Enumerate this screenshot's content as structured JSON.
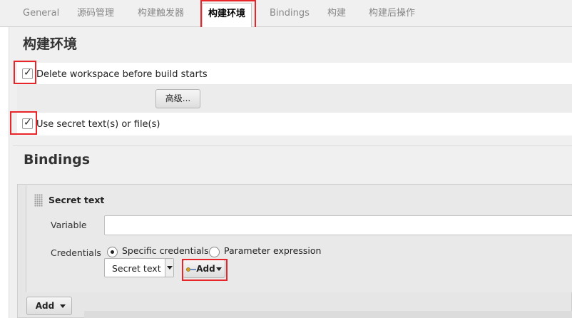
{
  "tabs": [
    {
      "label": "General",
      "active": false
    },
    {
      "label": "源码管理",
      "active": false
    },
    {
      "label": "构建触发器",
      "active": false
    },
    {
      "label": "构建环境",
      "active": true
    },
    {
      "label": "Bindings",
      "active": false
    },
    {
      "label": "构建",
      "active": false
    },
    {
      "label": "构建后操作",
      "active": false
    }
  ],
  "build_env": {
    "title": "构建环境",
    "delete_workspace_label": "Delete workspace before build starts",
    "delete_workspace_checked": true,
    "advanced_button": "高级...",
    "use_secret_label": "Use secret text(s) or file(s)",
    "use_secret_checked": true
  },
  "bindings": {
    "title": "Bindings",
    "card_title": "Secret text",
    "variable_label": "Variable",
    "variable_value": "",
    "credentials_label": "Credentials",
    "radio_specific": "Specific credentials",
    "radio_parameter": "Parameter expression",
    "selected_radio": "specific",
    "credential_select_value": "Secret text",
    "add_credential_button": "Add",
    "add_binding_button": "Add"
  },
  "colors": {
    "highlight": "#e8262a",
    "tab_bar_bg": "#f0f0f0",
    "panel_bg": "#f0f0f0"
  },
  "icons": [
    "check-icon",
    "key-icon",
    "caret-down-icon",
    "drag-handle-icon"
  ]
}
